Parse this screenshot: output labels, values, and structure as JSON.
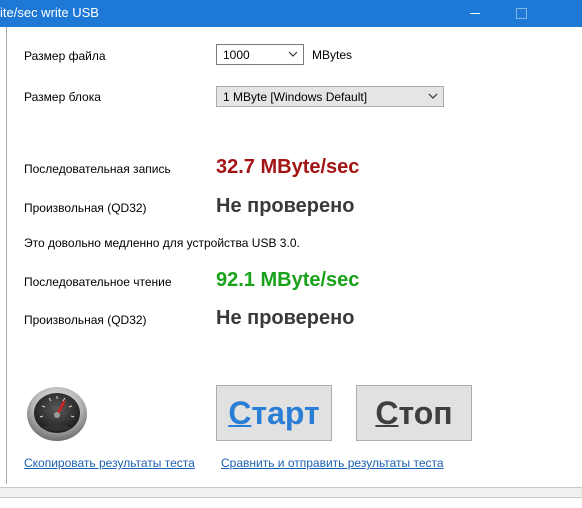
{
  "window": {
    "title": "ite/sec write USB",
    "colors": {
      "titlebar": "#1e78d6",
      "sequential_write": "#a31515",
      "sequential_read": "#1aa31a",
      "link": "#1a5fb4"
    }
  },
  "settings": {
    "file_size_label": "Размер файла",
    "file_size_value": "1000",
    "file_size_unit": "MBytes",
    "block_size_label": "Размер блока",
    "block_size_value": "1 MByte [Windows Default]"
  },
  "results": {
    "seq_write_label": "Последовательная запись",
    "seq_write_value": "32.7 MByte/sec",
    "rand_write_label": "Произвольная (QD32)",
    "rand_write_value": "Не проверено",
    "verdict": "Это довольно медленно для устройства USB 3.0.",
    "seq_read_label": "Последовательное чтение",
    "seq_read_value": "92.1 MByte/sec",
    "rand_read_label": "Произвольная (QD32)",
    "rand_read_value": "Не проверено"
  },
  "actions": {
    "start_first": "С",
    "start_rest": "тарт",
    "stop_first": "С",
    "stop_rest": "топ",
    "copy_link": "Скопировать результаты теста",
    "compare_link": "Сравнить и отправить результаты теста"
  },
  "icons": {
    "gauge": "speedometer-icon",
    "dropdown": "chevron-down-icon"
  }
}
